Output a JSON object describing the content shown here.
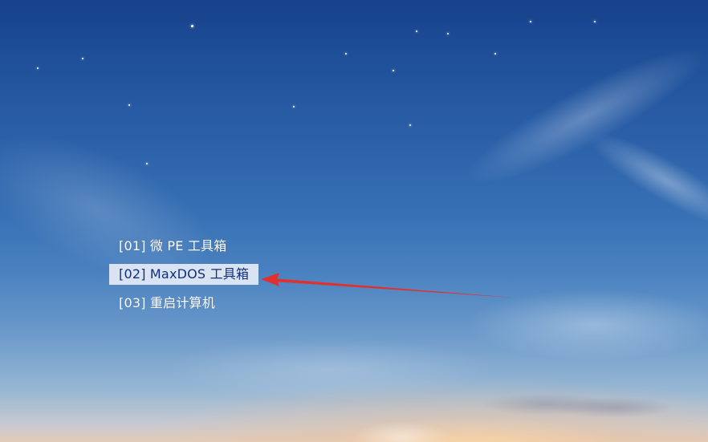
{
  "boot_menu": {
    "items": [
      {
        "label": "[01] 微 PE 工具箱",
        "selected": false
      },
      {
        "label": "[02] MaxDOS 工具箱",
        "selected": true
      },
      {
        "label": "[03] 重启计算机",
        "selected": false
      }
    ]
  },
  "annotation": {
    "arrow_color": "#e0312f",
    "target": "menu-item-02"
  },
  "colors": {
    "selection_bg": "#d9e3f1",
    "selection_text": "#11307a",
    "menu_text": "#ffffff"
  }
}
